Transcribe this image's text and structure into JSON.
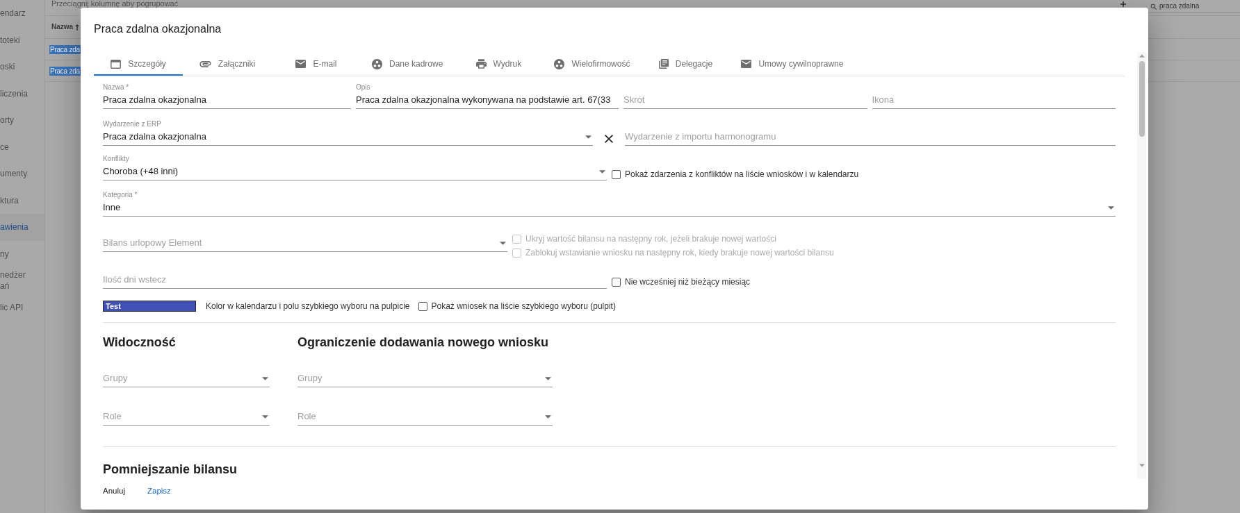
{
  "background": {
    "sidebar": {
      "items": [
        {
          "label": "endarz",
          "selected": false
        },
        {
          "label": "toteki",
          "selected": false
        },
        {
          "label": "oski",
          "selected": false
        },
        {
          "label": "liczenia",
          "selected": false
        },
        {
          "label": "orty",
          "selected": false
        },
        {
          "label": "ce",
          "selected": false
        },
        {
          "label": "umenty",
          "selected": false
        },
        {
          "label": "ktura",
          "selected": false
        },
        {
          "label": "awienia",
          "selected": true
        },
        {
          "label": "ny",
          "selected": false
        },
        {
          "label": "nedżer ań",
          "selected": false
        },
        {
          "label": "lic API",
          "selected": false
        }
      ]
    },
    "toolbar": {
      "group_hint": "Przeciągnij kolumnę aby pogrupować",
      "search": {
        "value": "praca zdalna"
      }
    },
    "table": {
      "columns": [
        {
          "label": "Nazwa",
          "sorted_ascending": true
        }
      ],
      "rows": [
        {
          "cells": [
            "Praca zda"
          ],
          "selected": true
        },
        {
          "cells": [
            "Praca zda"
          ],
          "selected": true
        }
      ]
    }
  },
  "dialog": {
    "title": "Praca zdalna okazjonalna",
    "tabs": [
      {
        "label": "Szczegóły",
        "selected": true
      },
      {
        "label": "Załączniki",
        "selected": false
      },
      {
        "label": "E-mail",
        "selected": false
      },
      {
        "label": "Dane kadrowe",
        "selected": false
      },
      {
        "label": "Wydruk",
        "selected": false
      },
      {
        "label": "Wielofirmowość",
        "selected": false
      },
      {
        "label": "Delegacje",
        "selected": false
      },
      {
        "label": "Umowy cywilnoprawne",
        "selected": false
      }
    ],
    "fields": {
      "name": {
        "label": "Nazwa *",
        "value": "Praca zdalna okazjonalna"
      },
      "description": {
        "label": "Opis",
        "value": "Praca zdalna okazjonalna wykonywana na podstawie art. 67(33"
      },
      "abbreviation": {
        "placeholder": "Skrót"
      },
      "icon": {
        "placeholder": "Ikona"
      },
      "erp_event": {
        "label": "Wydarzenie z ERP",
        "value": "Praca zdalna okazjonalna"
      },
      "schedule_import_event": {
        "placeholder": "Wydarzenie z importu harmonogramu"
      },
      "conflicts": {
        "label": "Konflikty",
        "value": "Choroba (+48 inni)"
      },
      "show_conflicts": {
        "label": "Pokaż zdarzenia z konfliktów na liście wniosków i w kalendarzu",
        "checked": false,
        "disabled": false
      },
      "category": {
        "label": "Kategoria *",
        "value": "Inne"
      },
      "leave_balance": {
        "placeholder": "Bilans urlopowy Element"
      },
      "balance_options": [
        {
          "label": "Ukryj wartość bilansu na następny rok, jeżeli brakuje nowej wartości",
          "checked": false,
          "disabled": true
        },
        {
          "label": "Zablokuj wstawianie wniosku na następny rok, kiedy brakuje nowej wartości bilansu",
          "checked": false,
          "disabled": true
        }
      ],
      "days_back": {
        "placeholder": "Ilość dni wstecz"
      },
      "not_earlier_than_current_month": {
        "label": "Nie wcześniej niż bieżący miesiąc",
        "checked": false,
        "disabled": false
      },
      "calendar_color": {
        "value": "Test",
        "color": "#3f51b5",
        "label": "Kolor w kalendarzu i polu szybkiego wyboru na pulpicie"
      },
      "show_in_quick_pick": {
        "label": "Pokaż wniosek na liście szybkiego wyboru (pulpit)",
        "checked": false,
        "disabled": false
      }
    },
    "sections": [
      {
        "title": "Widoczność",
        "fields": [
          {
            "placeholder": "Grupy"
          },
          {
            "placeholder": "Role"
          }
        ]
      },
      {
        "title": "Ograniczenie dodawania nowego wniosku",
        "fields": [
          {
            "placeholder": "Grupy"
          },
          {
            "placeholder": "Role"
          }
        ]
      }
    ],
    "next_section": {
      "title": "Pomniejszanie bilansu"
    },
    "buttons": [
      {
        "label": "Anuluj",
        "kind": "secondary"
      },
      {
        "label": "Zapisz",
        "kind": "primary"
      }
    ]
  }
}
